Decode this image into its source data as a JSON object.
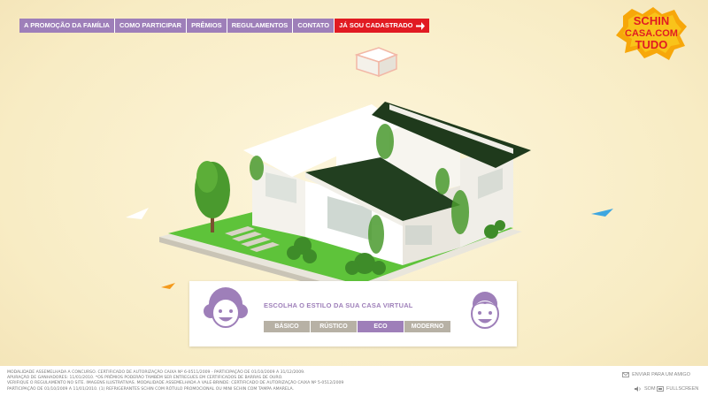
{
  "nav": {
    "items": [
      {
        "label": "A PROMOÇÃO DA FAMÍLIA"
      },
      {
        "label": "COMO PARTICIPAR"
      },
      {
        "label": "PRÊMIOS"
      },
      {
        "label": "REGULAMENTOS"
      },
      {
        "label": "CONTATO"
      }
    ],
    "cta": {
      "label": "JÁ SOU CADASTRADO"
    }
  },
  "logo": {
    "line1": "SCHIN",
    "line2": "CASA.COM",
    "line3": "TUDO"
  },
  "style_panel": {
    "title": "ESCOLHA O ESTILO DA SUA CASA VIRTUAL",
    "options": [
      {
        "label": "BÁSICO",
        "active": false
      },
      {
        "label": "RÚSTICO",
        "active": false
      },
      {
        "label": "ECO",
        "active": true
      },
      {
        "label": "MODERNO",
        "active": false
      }
    ]
  },
  "footer": {
    "legal": [
      "MODALIDADE ASSEMELHADA A CONCURSO. CERTIFICADO DE AUTORIZAÇÃO CAIXA Nº 6-0511/2009 - PARTICIPAÇÃO DE 01/10/2009 A 31/12/2009.",
      "APURAÇÃO DE GANHADORES: 11/01/2010. *OS PRÊMIOS PODERÃO TAMBÉM SER ENTREGUES EM CERTIFICADOS DE BARRAS DE OURO.",
      "VERIFIQUE O REGULAMENTO NO SITE. IMAGENS ILUSTRATIVAS. MODALIDADE ASSEMELHADA A VALE-BRINDE: CERTIFICADO DE AUTORIZAÇÃO CAIXA Nº 5-0512/2009",
      "PARTICIPAÇÃO DE 01/10/2009 A 11/01/2010. (1) REFRIGERANTES SCHIN COM RÓTULO PROMOCIONAL OU MINI SCHIN COM TAMPA AMARELA."
    ],
    "send_label": "ENVIAR PARA UM AMIGO",
    "sound_label": "SOM",
    "fullscreen_label": "FULLSCREEN"
  },
  "colors": {
    "accent": "#9e7fb9",
    "cta": "#e11b22",
    "background": "#faefca",
    "inactive": "#b7b1a5"
  }
}
